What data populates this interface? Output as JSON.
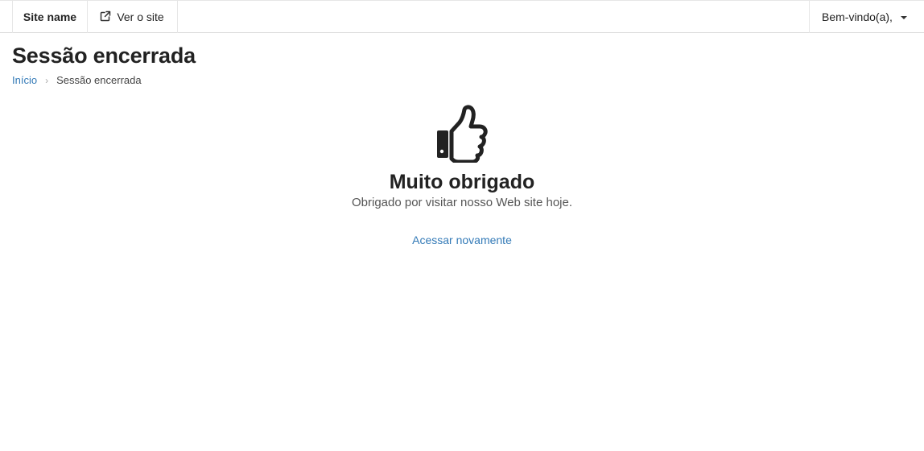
{
  "topbar": {
    "site_name": "Site name",
    "view_site_label": "Ver o site",
    "view_site_icon": "external-link-icon",
    "user_greeting": "Bem-vindo(a),",
    "user_menu_icon": "caret-down-icon"
  },
  "page": {
    "title": "Sessão encerrada"
  },
  "breadcrumb": {
    "home": "Início",
    "separator": "›",
    "current": "Sessão encerrada"
  },
  "main": {
    "icon": "thumbs-up-icon",
    "heading": "Muito obrigado",
    "message": "Obrigado por visitar nosso Web site hoje.",
    "relogin_link": "Acessar novamente"
  },
  "colors": {
    "link": "#337ab7",
    "text": "#222222",
    "muted": "#555555"
  }
}
